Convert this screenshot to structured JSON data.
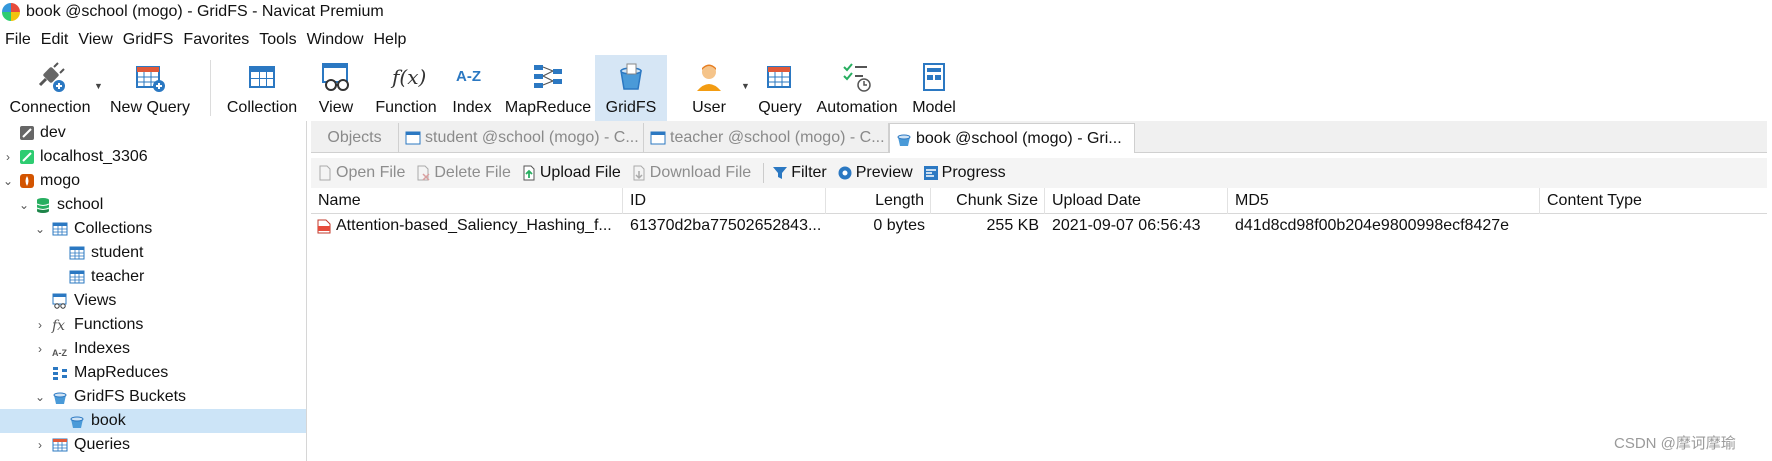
{
  "window": {
    "title": "book @school (mogo) - GridFS - Navicat Premium"
  },
  "menu": [
    "File",
    "Edit",
    "View",
    "GridFS",
    "Favorites",
    "Tools",
    "Window",
    "Help"
  ],
  "toolbar": {
    "connection": "Connection",
    "new_query": "New Query",
    "collection": "Collection",
    "view": "View",
    "function": "Function",
    "index": "Index",
    "mapreduce": "MapReduce",
    "gridfs": "GridFS",
    "user": "User",
    "query": "Query",
    "automation": "Automation",
    "model": "Model",
    "index_glyph": "A-Z",
    "function_glyph": "f(x)"
  },
  "tree": {
    "dev": "dev",
    "localhost": "localhost_3306",
    "mogo": "mogo",
    "school": "school",
    "collections": "Collections",
    "student": "student",
    "teacher": "teacher",
    "views": "Views",
    "functions": "Functions",
    "indexes": "Indexes",
    "mapreduces": "MapReduces",
    "gridfs_buckets": "GridFS Buckets",
    "book": "book",
    "queries": "Queries",
    "functions_glyph": "fx",
    "indexes_glyph": "A-Z"
  },
  "tabs": {
    "objects": "Objects",
    "student": "student @school (mogo) - C...",
    "teacher": "teacher @school (mogo) - C...",
    "book": "book @school (mogo) - Gri..."
  },
  "actions": {
    "open_file": "Open File",
    "delete_file": "Delete File",
    "upload_file": "Upload File",
    "download_file": "Download File",
    "filter": "Filter",
    "preview": "Preview",
    "progress": "Progress"
  },
  "table": {
    "columns": {
      "name": "Name",
      "id": "ID",
      "length": "Length",
      "chunk_size": "Chunk Size",
      "upload_date": "Upload Date",
      "md5": "MD5",
      "content_type": "Content Type"
    },
    "rows": [
      {
        "name": "Attention-based_Saliency_Hashing_f...",
        "id": "61370d2ba77502652843...",
        "length": "0 bytes",
        "chunk_size": "255 KB",
        "upload_date": "2021-09-07 06:56:43",
        "md5": "d41d8cd98f00b204e9800998ecf8427e",
        "content_type": ""
      }
    ]
  },
  "watermark": "CSDN @摩诃摩瑜",
  "colors": {
    "accent": "#2b78c2",
    "selected": "#cce4f7",
    "active_tool": "#d6e6f5"
  }
}
